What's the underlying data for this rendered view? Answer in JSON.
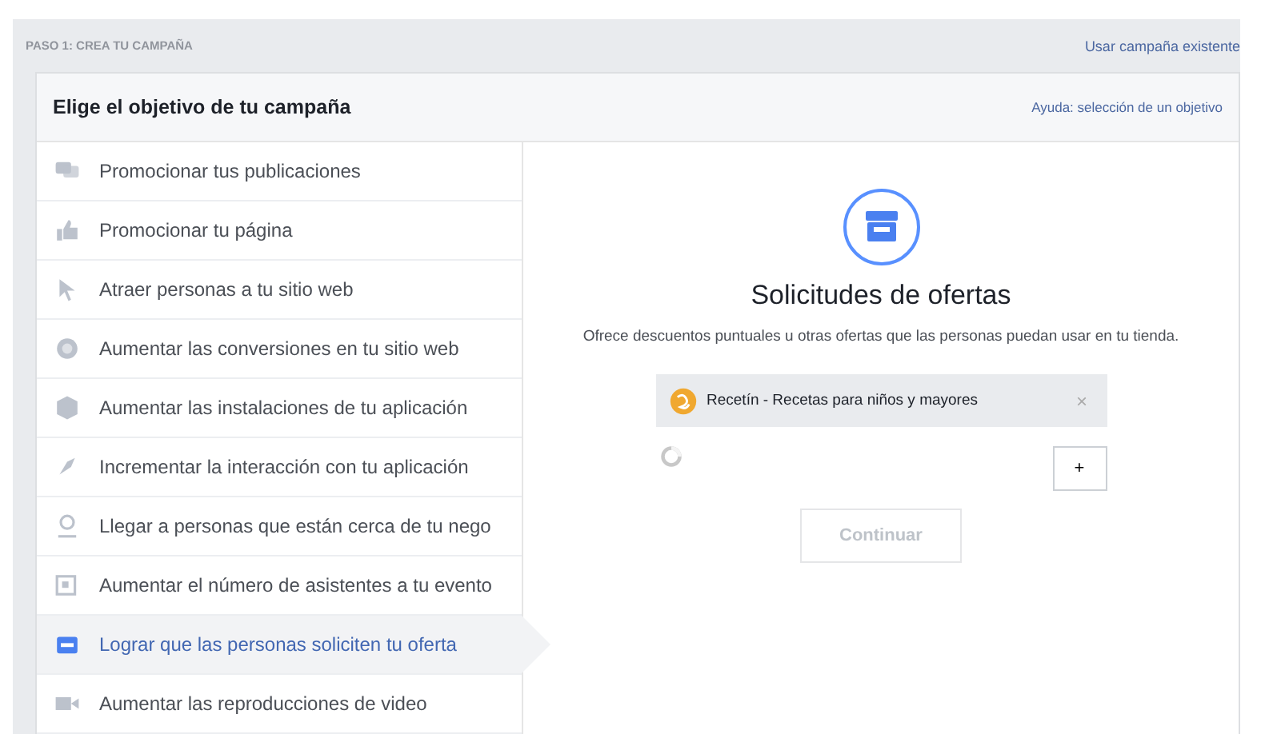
{
  "step_label": "PASO 1: CREA TU CAMPAÑA",
  "existing_link": "Usar campaña existente",
  "card": {
    "title": "Elige el objetivo de tu campaña",
    "help_link": "Ayuda: selección de un objetivo"
  },
  "objectives": [
    {
      "label": "Promocionar tus publicaciones",
      "selected": false
    },
    {
      "label": "Promocionar tu página",
      "selected": false
    },
    {
      "label": "Atraer personas a tu sitio web",
      "selected": false
    },
    {
      "label": "Aumentar las conversiones en tu sitio web",
      "selected": false
    },
    {
      "label": "Aumentar las instalaciones de tu aplicación",
      "selected": false
    },
    {
      "label": "Incrementar la interacción con tu aplicación",
      "selected": false
    },
    {
      "label": "Llegar a personas que están cerca de tu nego",
      "selected": false
    },
    {
      "label": "Aumentar el número de asistentes a tu evento",
      "selected": false
    },
    {
      "label": "Lograr que las personas soliciten tu oferta",
      "selected": true
    },
    {
      "label": "Aumentar las reproducciones de video",
      "selected": false
    }
  ],
  "detail": {
    "title": "Solicitudes de ofertas",
    "description": "Ofrece descuentos puntuales u otras ofertas que las personas puedan usar en tu tienda.",
    "page_chip": {
      "name": "Recetín - Recetas para niños y mayores",
      "remove": "×"
    },
    "add_button": "+",
    "continue_button": {
      "label": "Continuar",
      "disabled": true
    }
  }
}
